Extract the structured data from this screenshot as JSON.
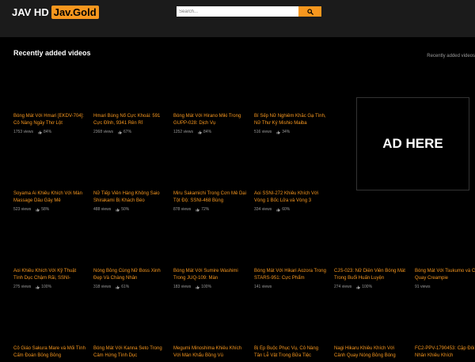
{
  "header": {
    "logo_part1": "JAV HD",
    "logo_part2": "Jav.Gold",
    "search_placeholder": "Search..."
  },
  "section": {
    "title": "Recently added videos",
    "right_label": "Recently added videos"
  },
  "ad": {
    "text": "AD HERE"
  },
  "videos": [
    {
      "title": "Bóng Mát Với Hmari [EKDV-704]: Cô Nàng Ngây Thơ Lột",
      "views": "1753 views",
      "rating": "84%"
    },
    {
      "title": "Hmari Bùng Nổ Cực Khoái: 591 Cực Đỉnh, 9341 Rên Rỉ",
      "views": "2368 views",
      "rating": "67%"
    },
    {
      "title": "Bóng Mát Với Hirano Miki Trong GUPP-028: Dịch Vụ",
      "views": "1252 views",
      "rating": "84%"
    },
    {
      "title": "Bí Sếp Nữ Nghiêm Khắc Gạ Tình, Nữ Thư Ký Mishio Maiba",
      "views": "516 views",
      "rating": "34%"
    },
    {
      "title": "Soyama Ai Khiêu Khích Với Màn Massage Dâu Gây Mê",
      "views": "523 views",
      "rating": "58%"
    },
    {
      "title": "Nữ Tiếp Viên Hàng Không Saio Shirakami Bị Khách Béo",
      "views": "488 views",
      "rating": "50%"
    },
    {
      "title": "Miru Sakamichi Trong Cơn Mê Dại Tột Độ: SSNI-468 Bùng",
      "views": "878 views",
      "rating": "72%"
    },
    {
      "title": "Aoi SSNI-272 Khiêu Khích Với Vòng 1 Bốc Lửa và Vòng 3",
      "views": "334 views",
      "rating": "60%"
    },
    {
      "title": "Aoi Khiêu Khích Với Kỹ Thuật Tình Dục Chậm Rãi, SSNI-",
      "views": "275 views",
      "rating": "100%"
    },
    {
      "title": "Nóng Bỏng Cùng Nữ Boss Xinh Đẹp Và Chàng Nhân",
      "views": "318 views",
      "rating": "61%"
    },
    {
      "title": "Bóng Mát Với Sumire Washimi Trong JUQ-109: Màn",
      "views": "183 views",
      "rating": "100%"
    },
    {
      "title": "Bóng Mát Với Hikari Aozora Trong STARS-951: Cực Phẩm",
      "views": "141 views",
      "rating": ""
    },
    {
      "title": "CJS-023: Nữ Diễn Viên Bóng Mát Trong Buổi Huấn Luyện",
      "views": "274 views",
      "rating": "100%"
    },
    {
      "title": "Bóng Mát Với Tsukumo và Cảnh Quay Creampie",
      "views": "91 views",
      "rating": ""
    },
    {
      "title": "Cô Giáo Sakura Mare và Mối Tình Cấm Đoán Bỏng Bỏng",
      "views": "",
      "rating": ""
    },
    {
      "title": "Bóng Mát Với Kanna Seto Trong Cảm Hứng Tình Dục",
      "views": "",
      "rating": ""
    },
    {
      "title": "Megumi Minoshima Khiêu Khích Với Màn Khẩu Bồng Vú",
      "views": "",
      "rating": ""
    },
    {
      "title": "Bị Ép Buộc Phục Vụ, Cô Nàng Tân Lễ Vật Trong Bữa Tiệc",
      "views": "",
      "rating": ""
    },
    {
      "title": "Nagi Hikaru Khiêu Khích Với Cảnh Quay Nóng Bỏng Bóng",
      "views": "",
      "rating": ""
    },
    {
      "title": "FC2-PPV-1790453: Cặp Đôi Tình Nhân Khiêu Khích",
      "views": "",
      "rating": ""
    }
  ]
}
